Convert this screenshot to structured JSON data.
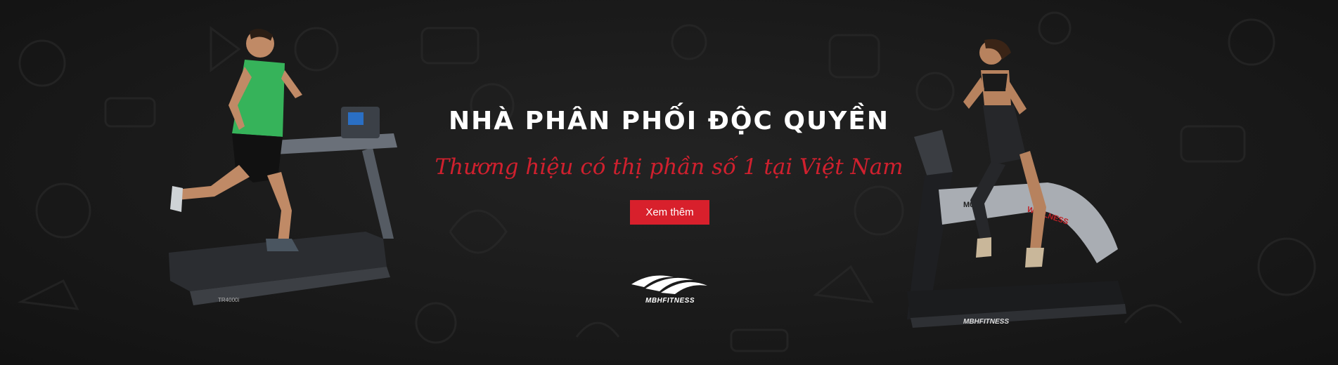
{
  "banner": {
    "headline": "NHÀ PHÂN PHỐI ĐỘC QUYỀN",
    "tagline": "Thương hiệu có thị phần số 1 tại Việt Nam",
    "cta_label": "Xem thêm",
    "logo_text": "MBHFITNESS",
    "left_treadmill_model": "TR4000i",
    "right_treadmill_brand": "WELLNESS",
    "right_treadmill_model": "M00Z",
    "right_treadmill_base_text": "MBHFITNESS",
    "colors": {
      "background": "#1a1a1a",
      "accent_red": "#d8202c",
      "headline": "#ffffff"
    }
  }
}
